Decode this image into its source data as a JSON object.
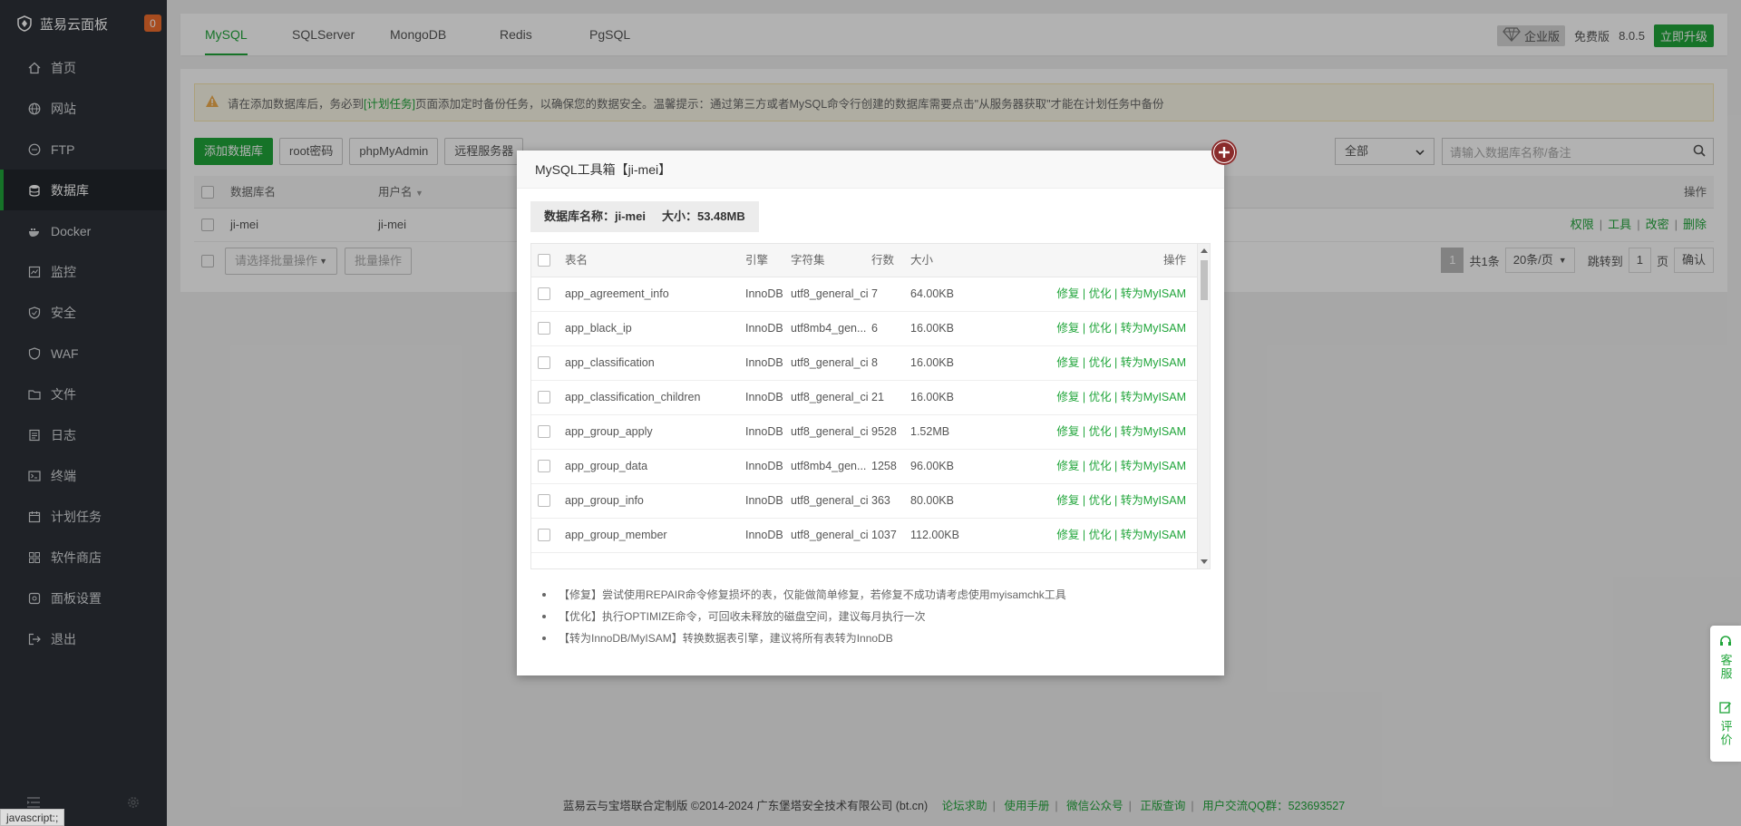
{
  "sidebar": {
    "brand": "蓝易云面板",
    "badge": "0",
    "items": [
      {
        "label": "首页",
        "icon": "home-icon"
      },
      {
        "label": "网站",
        "icon": "globe-icon"
      },
      {
        "label": "FTP",
        "icon": "ftp-icon"
      },
      {
        "label": "数据库",
        "icon": "database-icon",
        "active": true
      },
      {
        "label": "Docker",
        "icon": "docker-icon"
      },
      {
        "label": "监控",
        "icon": "monitor-icon"
      },
      {
        "label": "安全",
        "icon": "shield-icon"
      },
      {
        "label": "WAF",
        "icon": "waf-icon"
      },
      {
        "label": "文件",
        "icon": "folder-icon"
      },
      {
        "label": "日志",
        "icon": "log-icon"
      },
      {
        "label": "终端",
        "icon": "terminal-icon"
      },
      {
        "label": "计划任务",
        "icon": "calendar-icon"
      },
      {
        "label": "软件商店",
        "icon": "grid-icon"
      },
      {
        "label": "面板设置",
        "icon": "settings-icon"
      },
      {
        "label": "退出",
        "icon": "logout-icon"
      }
    ]
  },
  "tabs": [
    "MySQL",
    "SQLServer",
    "MongoDB",
    "Redis",
    "PgSQL"
  ],
  "topright": {
    "enterprise": "企业版",
    "free": "免费版",
    "version": "8.0.5",
    "upgrade": "立即升级"
  },
  "warning": {
    "prefix": "请在添加数据库后，务必到",
    "link": "[计划任务]",
    "suffix": "页面添加定时备份任务，以确保您的数据安全。温馨提示：通过第三方或者MySQL命令行创建的数据库需要点击\"从服务器获取\"才能在计划任务中备份"
  },
  "toolbar": {
    "add": "添加数据库",
    "root": "root密码",
    "pma": "phpMyAdmin",
    "remote": "远程服务器"
  },
  "filter": {
    "select": "全部",
    "search_placeholder": "请输入数据库名称/备注"
  },
  "db_table": {
    "col_name": "数据库名",
    "col_user": "用户名",
    "col_ops": "操作",
    "row": {
      "name": "ji-mei",
      "user": "ji-mei"
    },
    "ops": [
      "权限",
      "工具",
      "改密",
      "删除"
    ]
  },
  "batch": {
    "select": "请选择批量操作",
    "button": "批量操作"
  },
  "pager": {
    "current": "1",
    "total": "共1条",
    "per_page": "20条/页",
    "jump": "跳转到",
    "page_input": "1",
    "page_unit": "页",
    "confirm": "确认"
  },
  "footer": {
    "copyright": "蓝易云与宝塔联合定制版 ©2014-2024 广东堡塔安全技术有限公司 (bt.cn)",
    "links": [
      "论坛求助",
      "使用手册",
      "微信公众号",
      "正版查询"
    ],
    "qq": "用户交流QQ群：523693527"
  },
  "modal": {
    "title": "MySQL工具箱【ji-mei】",
    "db_name": "数据库名称：ji-mei",
    "db_size": "大小：53.48MB",
    "headers": {
      "name": "表名",
      "engine": "引擎",
      "charset": "字符集",
      "rows": "行数",
      "size": "大小",
      "ops": "操作"
    },
    "row_ops": "修复 | 优化 | 转为MyISAM",
    "rows": [
      {
        "name": "app_agreement_info",
        "engine": "InnoDB",
        "charset": "utf8_general_ci",
        "rows": "7",
        "size": "64.00KB"
      },
      {
        "name": "app_black_ip",
        "engine": "InnoDB",
        "charset": "utf8mb4_gen...",
        "rows": "6",
        "size": "16.00KB"
      },
      {
        "name": "app_classification",
        "engine": "InnoDB",
        "charset": "utf8_general_ci",
        "rows": "8",
        "size": "16.00KB"
      },
      {
        "name": "app_classification_children",
        "engine": "InnoDB",
        "charset": "utf8_general_ci",
        "rows": "21",
        "size": "16.00KB"
      },
      {
        "name": "app_group_apply",
        "engine": "InnoDB",
        "charset": "utf8_general_ci",
        "rows": "9528",
        "size": "1.52MB"
      },
      {
        "name": "app_group_data",
        "engine": "InnoDB",
        "charset": "utf8mb4_gen...",
        "rows": "1258",
        "size": "96.00KB"
      },
      {
        "name": "app_group_info",
        "engine": "InnoDB",
        "charset": "utf8_general_ci",
        "rows": "363",
        "size": "80.00KB"
      },
      {
        "name": "app_group_member",
        "engine": "InnoDB",
        "charset": "utf8_general_ci",
        "rows": "1037",
        "size": "112.00KB"
      }
    ],
    "tips": [
      "【修复】尝试使用REPAIR命令修复损坏的表，仅能做简单修复，若修复不成功请考虑使用myisamchk工具",
      "【优化】执行OPTIMIZE命令，可回收未释放的磁盘空间，建议每月执行一次",
      "【转为InnoDB/MyISAM】转换数据表引擎，建议将所有表转为InnoDB"
    ]
  },
  "side_help": {
    "service": "客服",
    "review": "评价"
  },
  "status_bar": "javascript:;",
  "colors": {
    "accent": "#20a53a",
    "sidebar": "#2d3138"
  }
}
